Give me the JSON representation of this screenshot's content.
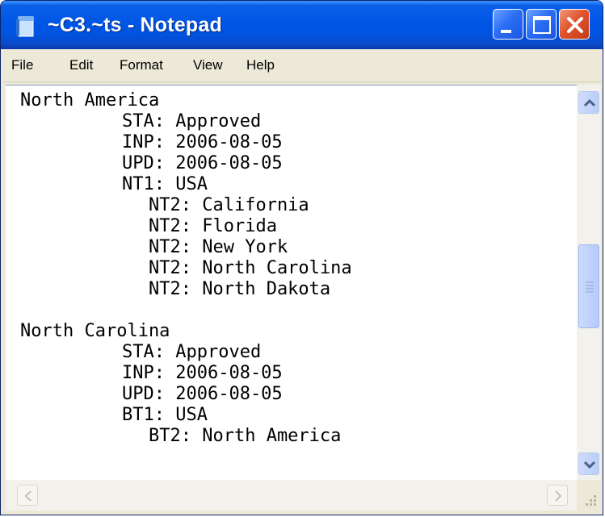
{
  "window": {
    "title": "~C3.~ts - Notepad",
    "app_icon": "notepad-icon",
    "controls": [
      "minimize-icon",
      "maximize-icon",
      "close-icon"
    ]
  },
  "menu": {
    "file": "File",
    "edit": "Edit",
    "format": "Format",
    "view": "View",
    "help": "Help"
  },
  "document": {
    "lines": [
      "North America",
      "STA: Approved",
      "INP: 2006-08-05",
      "UPD: 2006-08-05",
      "NT1: USA",
      "NT2: California",
      "NT2: Florida",
      "NT2: New York",
      "NT2: North Carolina",
      "NT2: North Dakota",
      "",
      "North Carolina",
      "STA: Approved",
      "INP: 2006-08-05",
      "UPD: 2006-08-05",
      "BT1: USA",
      "BT2: North America"
    ]
  },
  "colors": {
    "titlebar": "#0056e6",
    "close_button": "#e0552f",
    "window_face": "#ece9d8",
    "scrollbar": "#b9cef8"
  }
}
